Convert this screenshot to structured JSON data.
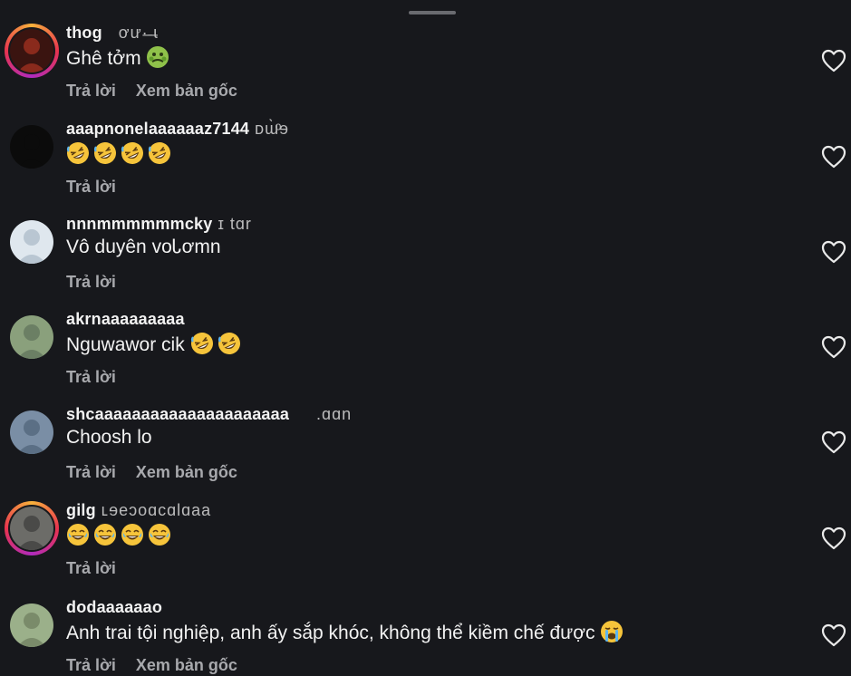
{
  "reply_label": "Trả lời",
  "see_original_label": "Xem bản gốc",
  "comments": [
    {
      "username": "thog",
      "username_obscured": "   ơư·̶ ̶ɩ",
      "text": "Ghê tởm",
      "emoji": [
        "nauseated-face"
      ],
      "show_original": true,
      "avatar_color": "#8a2a1c",
      "story_ring": true
    },
    {
      "username": "aaapnonelaaaaaaz7144",
      "username_obscured": " ᴅɯ̀ͦɘ",
      "text": "",
      "emoji": [
        "rofl",
        "rofl",
        "rofl",
        "rofl"
      ],
      "show_original": false,
      "avatar_color": "#0b0b0b",
      "story_ring": false
    },
    {
      "username": "nnnmmmmmmcky",
      "username_obscured": " ɪ tɑr",
      "text": "Vô duyên voᏓơmn",
      "emoji": [],
      "show_original": false,
      "avatar_color": "#b9c6d2",
      "story_ring": false
    },
    {
      "username": "akrnaaaaaaaaa",
      "username_obscured": "",
      "text": "Nguwawor cik",
      "emoji": [
        "rofl",
        "rofl"
      ],
      "show_original": false,
      "avatar_color": "#6b7f64",
      "story_ring": false
    },
    {
      "username": "shcaaaaaaaaaaaaaaaaaaaaa",
      "username_obscured": "     .ɑɑn",
      "text": "Choosh lo",
      "emoji": [],
      "show_original": true,
      "avatar_color": "#5b6f85",
      "story_ring": false
    },
    {
      "username": "gilg",
      "username_obscured": " ʟɘeɔoɑcɑlɑaa",
      "text": "",
      "emoji": [
        "joy",
        "joy",
        "joy",
        "joy"
      ],
      "show_original": false,
      "avatar_color": "#4a4a48",
      "story_ring": true
    },
    {
      "username": "dodaaaaaao",
      "username_obscured": "",
      "text": "Anh trai tội nghiệp, anh ấy sắp khóc, không thể kiềm chế được",
      "emoji": [
        "loudly-crying"
      ],
      "show_original": true,
      "avatar_color": "#7a8b6a",
      "story_ring": false
    }
  ]
}
